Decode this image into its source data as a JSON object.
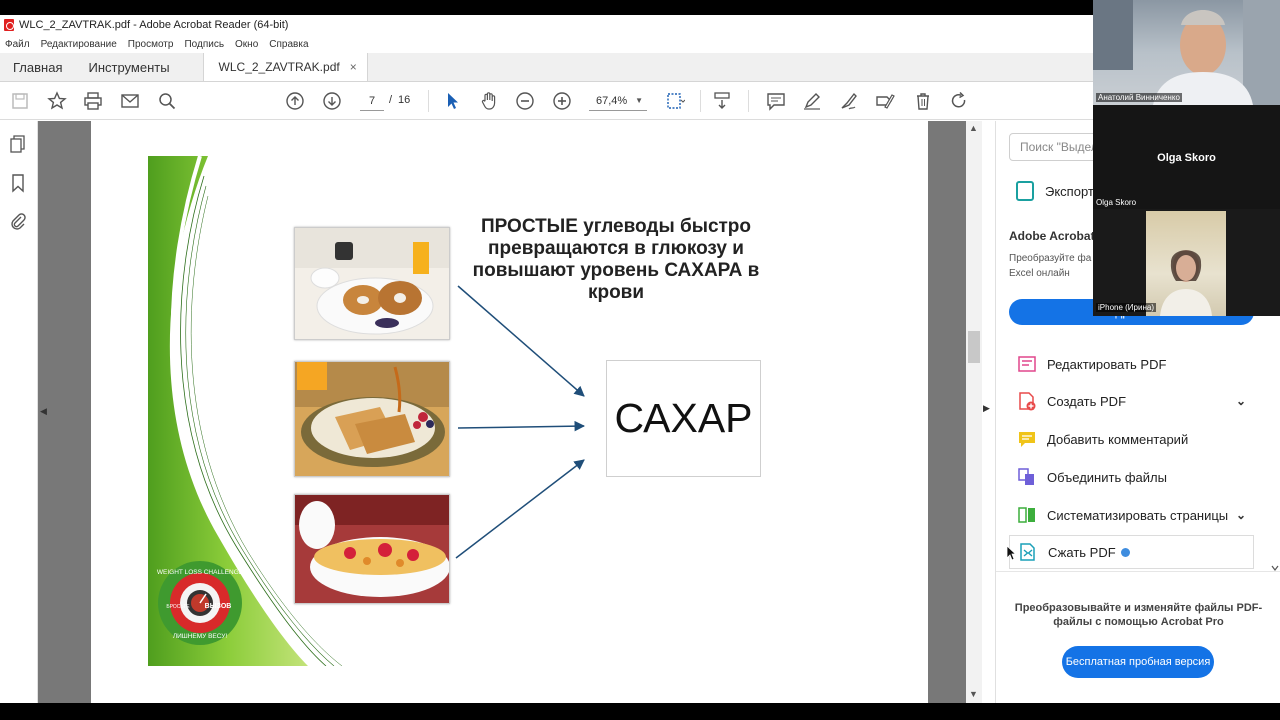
{
  "window": {
    "title": "WLC_2_ZAVTRAK.pdf - Adobe Acrobat Reader (64-bit)"
  },
  "menu": [
    "Файл",
    "Редактирование",
    "Просмотр",
    "Подпись",
    "Окно",
    "Справка"
  ],
  "tabs": {
    "home": "Главная",
    "tools": "Инструменты",
    "document": "WLC_2_ZAVTRAK.pdf",
    "close": "×"
  },
  "toolbar": {
    "page_current": "7",
    "page_separator": "/",
    "page_total": "16",
    "zoom": "67,4%"
  },
  "slide": {
    "heading": "ПРОСТЫЕ углеводы быстро превращаются в глюкозу и повышают уровень САХАРА в крови",
    "target": "САХАР",
    "logo_top": "WEIGHT LOSS CHALLENGE",
    "logo_mid": "ВЫЗОВ",
    "logo_side": "БРОСЬТЕ",
    "logo_bottom": "ЛИШНЕМУ ВЕСУ!"
  },
  "right_panel": {
    "search_placeholder": "Поиск \"Выдел",
    "export_label": "Экспорт",
    "promo_title": "Adobe Acrobat",
    "promo_text": "Преобразуйте фа Excel онлайн",
    "promo_button": "Подробнее",
    "tools": [
      {
        "label": "Редактировать PDF",
        "icon": "edit-pdf-icon",
        "color": "#e0468c"
      },
      {
        "label": "Создать PDF",
        "icon": "create-pdf-icon",
        "color": "#e84a4a"
      },
      {
        "label": "Добавить комментарий",
        "icon": "comment-icon",
        "color": "#f0c419"
      },
      {
        "label": "Объединить файлы",
        "icon": "combine-files-icon",
        "color": "#6e5fd8"
      },
      {
        "label": "Систематизировать страницы",
        "icon": "organize-pages-icon",
        "color": "#3cae3c"
      },
      {
        "label": "Сжать PDF",
        "icon": "compress-pdf-icon",
        "color": "#1aa0b8"
      }
    ],
    "pro_text": "Преобразовывайте и изменяйте файлы PDF-файлы с помощью Acrobat Pro",
    "trial_button": "Бесплатная пробная версия"
  },
  "video_call": {
    "participant_1": "Анатолий Винниченко",
    "participant_2": "Olga Skoro",
    "participant_3": "iPhone (Ирина)"
  },
  "colors": {
    "accent": "#1473e6",
    "green": "#6cb52d",
    "arrow": "#1f4e79"
  }
}
